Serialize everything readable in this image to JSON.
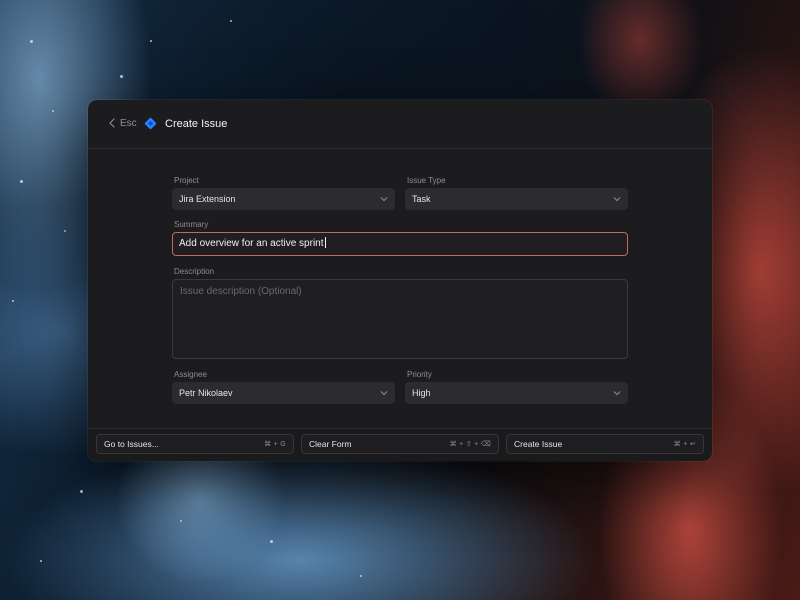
{
  "header": {
    "back_label": "Esc",
    "title": "Create Issue",
    "accent_color": "#2684ff"
  },
  "form": {
    "project": {
      "label": "Project",
      "value": "Jira Extension"
    },
    "issue_type": {
      "label": "Issue Type",
      "value": "Task"
    },
    "summary": {
      "label": "Summary",
      "value": "Add overview for an active sprint"
    },
    "description": {
      "label": "Description",
      "placeholder": "Issue description (Optional)"
    },
    "assignee": {
      "label": "Assignee",
      "value": "Petr Nikolaev"
    },
    "priority": {
      "label": "Priority",
      "value": "High"
    }
  },
  "footer": {
    "actions": [
      {
        "label": "Go to Issues...",
        "shortcut": "⌘ + G"
      },
      {
        "label": "Clear Form",
        "shortcut": "⌘ + ⇧ + ⌫"
      },
      {
        "label": "Create Issue",
        "shortcut": "⌘ + ↵"
      }
    ]
  },
  "icons": {
    "back": "chevron-left-icon",
    "app": "jira-logo-icon",
    "caret": "chevron-down-icon"
  }
}
